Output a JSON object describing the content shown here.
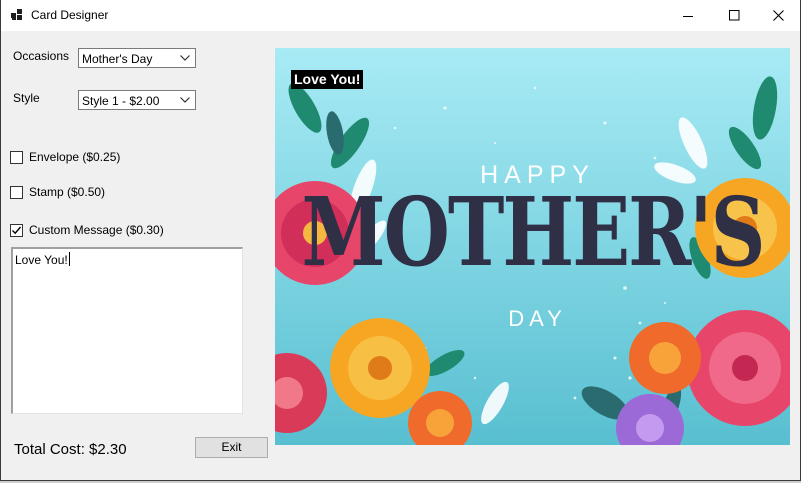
{
  "window": {
    "title": "Card Designer",
    "controls": [
      "minimize",
      "maximize",
      "close"
    ]
  },
  "occasions": {
    "label": "Occasions",
    "selected": "Mother's Day"
  },
  "style": {
    "label": "Style",
    "selected": "Style 1 - $2.00"
  },
  "options": [
    {
      "label": "Envelope ($0.25)",
      "checked": false
    },
    {
      "label": "Stamp ($0.50)",
      "checked": false
    },
    {
      "label": "Custom Message ($0.30)",
      "checked": true
    }
  ],
  "message": {
    "text": "Love You!"
  },
  "total": {
    "text": "Total Cost: $2.30"
  },
  "exit_button": {
    "label": "Exit"
  },
  "card_preview": {
    "message_overlay": "Love You!",
    "line1": "HAPPY",
    "line2": "MOTHER'S",
    "line3": "DAY",
    "colors": {
      "background": "#7fd6e6",
      "text_dark": "#2f2f45",
      "flower_pink": "#e8456a",
      "flower_orange": "#f6a623",
      "leaf_green": "#1f8a70"
    }
  }
}
